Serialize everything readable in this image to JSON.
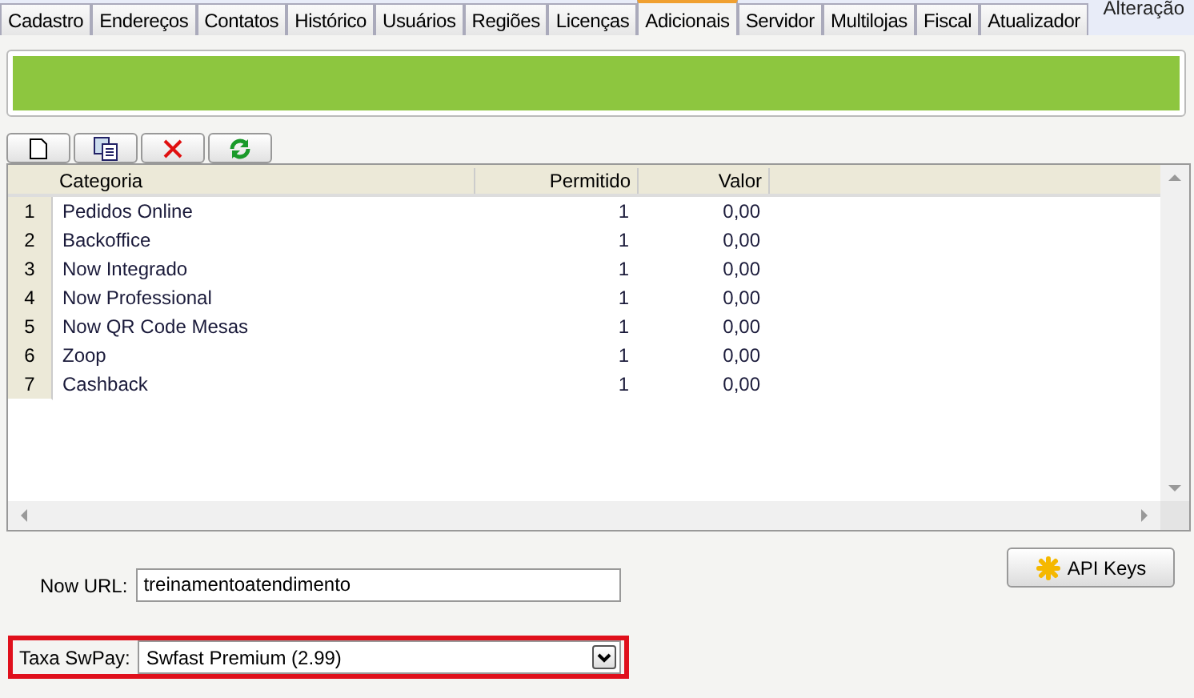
{
  "tabs": [
    {
      "label": "Cadastro",
      "selected": false
    },
    {
      "label": "Endereços",
      "selected": false
    },
    {
      "label": "Contatos",
      "selected": false
    },
    {
      "label": "Histórico",
      "selected": false
    },
    {
      "label": "Usuários",
      "selected": false
    },
    {
      "label": "Regiões",
      "selected": false
    },
    {
      "label": "Licenças",
      "selected": false
    },
    {
      "label": "Adicionais",
      "selected": true
    },
    {
      "label": "Servidor",
      "selected": false
    },
    {
      "label": "Multilojas",
      "selected": false
    },
    {
      "label": "Fiscal",
      "selected": false
    },
    {
      "label": "Atualizador",
      "selected": false
    }
  ],
  "corner_label": "Alteração",
  "table": {
    "columns": [
      "Categoria",
      "Permitido",
      "Valor"
    ],
    "rows": [
      {
        "index": "1",
        "categoria": "Pedidos Online",
        "permitido": "1",
        "valor": "0,00"
      },
      {
        "index": "2",
        "categoria": "Backoffice",
        "permitido": "1",
        "valor": "0,00"
      },
      {
        "index": "3",
        "categoria": "Now Integrado",
        "permitido": "1",
        "valor": "0,00"
      },
      {
        "index": "4",
        "categoria": "Now Professional",
        "permitido": "1",
        "valor": "0,00"
      },
      {
        "index": "5",
        "categoria": "Now QR Code Mesas",
        "permitido": "1",
        "valor": "0,00"
      },
      {
        "index": "6",
        "categoria": "Zoop",
        "permitido": "1",
        "valor": "0,00"
      },
      {
        "index": "7",
        "categoria": "Cashback",
        "permitido": "1",
        "valor": "0,00"
      }
    ]
  },
  "now_url": {
    "label": "Now URL:",
    "value": "treinamentoatendimento"
  },
  "taxa_swpay": {
    "label": "Taxa SwPay:",
    "value": "Swfast Premium (2.99)",
    "highlighted": true
  },
  "api_keys_button": "API Keys"
}
